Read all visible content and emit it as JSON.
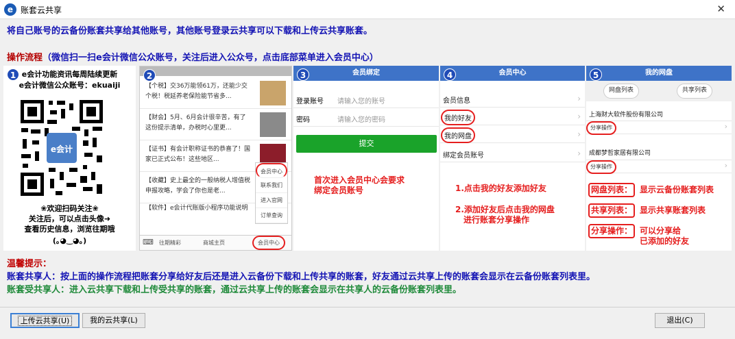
{
  "window": {
    "title": "账套云共享",
    "app_icon_letter": "e",
    "close_glyph": "✕"
  },
  "intro": "将自己账号的云备份账套共享给其他账号，其他账号登录云共享可以下载和上传云共享账套。",
  "flow": {
    "label": "操作流程",
    "text": "（微信扫一扫e会计微信公众账号，关注后进入公众号，点击底部菜单进入会员中心）"
  },
  "panels": {
    "p1": {
      "badge": "1",
      "top_line1": "e会计功能资讯每周陆续更新",
      "top_line2": "e会计微信公众账号：ekuaiji",
      "qr_center": "e会计",
      "bottom_line1": "❀欢迎扫码关注❀",
      "bottom_line2": "关注后，可以点击头像➜",
      "bottom_line3": "查看历史信息，浏览往期哦",
      "bottom_line4": "(｡◕‿◕｡)"
    },
    "p2": {
      "badge": "2",
      "news": [
        {
          "text": "【个税】交36万能领61万，还能少交个税！税延养老保险能节省多..."
        },
        {
          "text": "【财会】5月、6月会计很辛苦，有了这份提示清单，办税时心里更..."
        },
        {
          "text": "【证书】有会计职称证书的恭喜了！国家已正式公布！这些地区..."
        },
        {
          "text": "【收藏】史上最全的一般纳税人增值税申报攻略，学会了你也是老..."
        },
        {
          "text": "【软件】e会计代账版小程序功能说明"
        }
      ],
      "popup": [
        "会员中心",
        "联系我们",
        "进入官网",
        "订单查询"
      ],
      "bottom_bar": {
        "item1": "往期精彩",
        "item2": "商城主页",
        "item3": "会员中心"
      }
    },
    "p3": {
      "badge": "3",
      "header": "会员绑定",
      "account_label": "登录账号",
      "account_placeholder": "请输入您的账号",
      "password_label": "密码",
      "password_placeholder": "请输入您的密码",
      "submit": "提交",
      "note_line1": "首次进入会员中心会要求",
      "note_line2": "绑定会员账号"
    },
    "p4": {
      "badge": "4",
      "header": "会员中心",
      "items": [
        "会员信息",
        "我的好友",
        "我的网盘",
        "绑定会员账号"
      ],
      "note1": "1.点击我的好友添加好友",
      "note2_line1": "2.添加好友后点击我的网盘",
      "note2_line2": "进行账套分享操作"
    },
    "p5": {
      "badge": "5",
      "header": "我的网盘",
      "tab1": "网盘列表",
      "tab2": "共享列表",
      "company1": "上海财大软件股份有限公司",
      "company2": "成都梦哲家居有限公司",
      "share_op": "分享操作",
      "legend": [
        {
          "label": "网盘列表：",
          "desc": "显示云备份账套列表"
        },
        {
          "label": "共享列表：",
          "desc": "显示共享账套列表"
        },
        {
          "label": "分享操作：",
          "desc_line1": "可以分享给",
          "desc_line2": "已添加的好友"
        }
      ]
    }
  },
  "tips": {
    "heading": "温馨提示：",
    "line1": "账套共享人：按上面的操作流程把账套分享给好友后还是进入云备份下载和上传共享的账套，好友通过云共享上传的账套会显示在云备份账套列表里。",
    "line2": "账套受共享人：进入云共享下载和上传受共享的账套，通过云共享上传的账套会显示在共享人的云备份账套列表里。"
  },
  "buttons": {
    "upload": "上传云共享(U)",
    "mine": "我的云共享(L)",
    "exit": "退出(C)"
  },
  "colors": {
    "accent_blue": "#1414b4",
    "warning_red": "#e51e1e",
    "tip_green": "#1f8a3a",
    "wechat_green": "#1aa32a",
    "header_blue": "#3e73c8"
  }
}
